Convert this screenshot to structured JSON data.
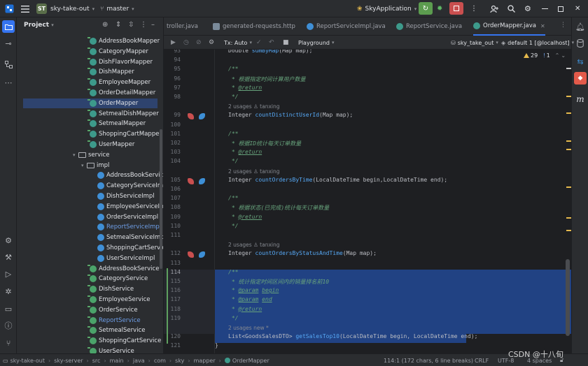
{
  "titlebar": {
    "project_badge": "ST",
    "project_name": "sky-take-out",
    "branch": "master",
    "run_config": "SkyApplication",
    "icons": [
      "hamburger-icon",
      "git-branch-icon",
      "rerun-icon",
      "debug-icon",
      "stop-icon",
      "more-icon",
      "add-user-icon",
      "search-icon",
      "gear-icon",
      "minimize-icon",
      "maximize-icon",
      "close-icon"
    ]
  },
  "left_stripe": [
    "project-icon",
    "commit-icon",
    "structure-icon",
    "more-tools-icon",
    "services-icon",
    "build-icon",
    "run-icon",
    "debug-icon",
    "terminal-icon",
    "problems-icon",
    "git-icon"
  ],
  "right_stripe": [
    "notifications-icon",
    "database-icon",
    "endpoints-icon",
    "maven-icon",
    "m-icon"
  ],
  "project_panel": {
    "title": "Project",
    "tree": [
      {
        "label": "AddressBookMapper",
        "kind": "iface",
        "indent": 0
      },
      {
        "label": "CategoryMapper",
        "kind": "iface",
        "indent": 0
      },
      {
        "label": "DishFlavorMapper",
        "kind": "iface",
        "indent": 0
      },
      {
        "label": "DishMapper",
        "kind": "iface",
        "indent": 0
      },
      {
        "label": "EmployeeMapper",
        "kind": "iface",
        "indent": 0
      },
      {
        "label": "OrderDetailMapper",
        "kind": "iface",
        "indent": 0
      },
      {
        "label": "OrderMapper",
        "kind": "iface",
        "indent": 0,
        "selected": true
      },
      {
        "label": "SetmealDishMapper",
        "kind": "iface",
        "indent": 0
      },
      {
        "label": "SetmealMapper",
        "kind": "iface",
        "indent": 0
      },
      {
        "label": "ShoppingCartMapper",
        "kind": "iface",
        "indent": 0
      },
      {
        "label": "UserMapper",
        "kind": "iface",
        "indent": 0
      },
      {
        "label": "service",
        "kind": "folder",
        "indent": -1
      },
      {
        "label": "impl",
        "kind": "folder",
        "indent": 0
      },
      {
        "label": "AddressBookServiceI",
        "kind": "class",
        "indent": 1
      },
      {
        "label": "CategoryServiceImpl",
        "kind": "class",
        "indent": 1
      },
      {
        "label": "DishServiceImpl",
        "kind": "class",
        "indent": 1
      },
      {
        "label": "EmployeeServiceImpl",
        "kind": "class",
        "indent": 1
      },
      {
        "label": "OrderServiceImpl",
        "kind": "class",
        "indent": 1
      },
      {
        "label": "ReportServiceImpl",
        "kind": "class",
        "indent": 1,
        "blue": true
      },
      {
        "label": "SetmealServiceImpl",
        "kind": "class",
        "indent": 1
      },
      {
        "label": "ShoppingCartServiceI",
        "kind": "class",
        "indent": 1
      },
      {
        "label": "UserServiceImpl",
        "kind": "class",
        "indent": 1
      },
      {
        "label": "AddressBookService",
        "kind": "iface2",
        "indent": 0
      },
      {
        "label": "CategoryService",
        "kind": "iface2",
        "indent": 0
      },
      {
        "label": "DishService",
        "kind": "iface2",
        "indent": 0
      },
      {
        "label": "EmployeeService",
        "kind": "iface2",
        "indent": 0
      },
      {
        "label": "OrderService",
        "kind": "iface2",
        "indent": 0
      },
      {
        "label": "ReportService",
        "kind": "iface2",
        "indent": 0,
        "blue": true
      },
      {
        "label": "SetmealService",
        "kind": "iface2",
        "indent": 0
      },
      {
        "label": "ShoppingCartService",
        "kind": "iface2",
        "indent": 0
      },
      {
        "label": "UserService",
        "kind": "iface2",
        "indent": 0
      }
    ]
  },
  "tabs": [
    {
      "label": "troller.java",
      "icon": "class"
    },
    {
      "label": "generated-requests.http",
      "icon": "http"
    },
    {
      "label": "ReportServiceImpl.java",
      "icon": "class"
    },
    {
      "label": "ReportService.java",
      "icon": "iface"
    },
    {
      "label": "OrderMapper.java",
      "icon": "iface",
      "active": true
    }
  ],
  "editor_toolbar": {
    "tx": "Tx: Auto",
    "playground": "Playground",
    "datasource": "sky_take_out",
    "schema": "default 1 [@localhost]"
  },
  "editor": {
    "warnings": "29",
    "errors": "1",
    "lines": [
      {
        "n": "93",
        "kind": "code",
        "html": "Double <span class='fn'>sumByMap</span>(Map map);"
      },
      {
        "n": "94",
        "kind": "blank"
      },
      {
        "n": "95",
        "kind": "code",
        "html": "<span class='doc'>/**</span>"
      },
      {
        "n": "96",
        "kind": "code",
        "html": "<span class='doc'> * 根据指定时间计算用户数量</span>"
      },
      {
        "n": "97",
        "kind": "code",
        "html": "<span class='doc'> * <span class='tag'>@return</span></span>"
      },
      {
        "n": "98",
        "kind": "code",
        "html": "<span class='doc'> */</span>"
      },
      {
        "n": "",
        "kind": "hint",
        "text": "2 usages    ♙ tanxing"
      },
      {
        "n": "99",
        "kind": "code",
        "icons": true,
        "html": "Integer <span class='fn'>countDistinctUserId</span>(Map map);"
      },
      {
        "n": "100",
        "kind": "blank"
      },
      {
        "n": "101",
        "kind": "code",
        "html": "<span class='doc'>/**</span>"
      },
      {
        "n": "102",
        "kind": "code",
        "html": "<span class='doc'> * 根据ID统计每天订单数量</span>"
      },
      {
        "n": "103",
        "kind": "code",
        "html": "<span class='doc'> * <span class='tag'>@return</span></span>"
      },
      {
        "n": "104",
        "kind": "code",
        "html": "<span class='doc'> */</span>"
      },
      {
        "n": "",
        "kind": "hint",
        "text": "2 usages    ♙ tanxing"
      },
      {
        "n": "105",
        "kind": "code",
        "icons": true,
        "html": "Integer <span class='fn'>countOrdersByTime</span>(LocalDateTime begin,LocalDateTime end);"
      },
      {
        "n": "106",
        "kind": "blank"
      },
      {
        "n": "107",
        "kind": "code",
        "html": "<span class='doc'>/**</span>"
      },
      {
        "n": "108",
        "kind": "code",
        "html": "<span class='doc'> * 根据状态(已完成)统计每天订单数量</span>"
      },
      {
        "n": "109",
        "kind": "code",
        "html": "<span class='doc'> * <span class='tag'>@return</span></span>"
      },
      {
        "n": "110",
        "kind": "code",
        "html": "<span class='doc'> */</span>"
      },
      {
        "n": "111",
        "kind": "blank"
      },
      {
        "n": "",
        "kind": "hint",
        "text": "2 usages    ♙ tanxing"
      },
      {
        "n": "112",
        "kind": "code",
        "icons": true,
        "html": "Integer <span class='fn'>countOrdersByStatusAndTime</span>(Map map);"
      },
      {
        "n": "113",
        "kind": "blank"
      },
      {
        "n": "114",
        "kind": "code",
        "html": "<span class='doc'>/**</span>"
      },
      {
        "n": "115",
        "kind": "code",
        "html": "<span class='doc'> * 统计指定时间区间内的销量排名前10</span>"
      },
      {
        "n": "116",
        "kind": "code",
        "html": "<span class='doc'> * <span class='tag'>@param</span> <span class='tag'>begin</span></span>"
      },
      {
        "n": "117",
        "kind": "code",
        "html": "<span class='doc'> * <span class='tag'>@param</span> <span class='tag'>end</span></span>"
      },
      {
        "n": "118",
        "kind": "code",
        "html": "<span class='doc'> * <span class='tag'>@return</span></span>"
      },
      {
        "n": "119",
        "kind": "code",
        "html": "<span class='doc'> */</span>"
      },
      {
        "n": "",
        "kind": "hint",
        "text": "2 usages    new *"
      },
      {
        "n": "120",
        "kind": "code",
        "html": "List&lt;GoodsSalesDTO&gt; <span class='fn'>getSalesTop10</span>(LocalDateTime begin, LocalDateTime end);"
      },
      {
        "n": "121",
        "kind": "code",
        "html": "}",
        "outer": true
      }
    ]
  },
  "statusbar": {
    "breadcrumb": [
      "sky-take-out",
      "sky-server",
      "src",
      "main",
      "java",
      "com",
      "sky",
      "mapper",
      "OrderMapper"
    ],
    "position": "114:1 (172 chars, 6 line breaks)",
    "line_ending": "CRLF",
    "encoding": "UTF-8",
    "indent": "4 spaces"
  },
  "watermark": "CSDN @十八旬"
}
